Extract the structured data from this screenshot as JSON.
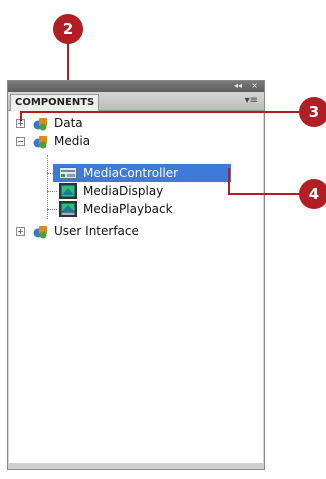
{
  "callouts": {
    "c2": "2",
    "c3": "3",
    "c4": "4"
  },
  "panel": {
    "tab_label": "COMPONENTS",
    "collapse_glyph": "◂◂",
    "close_glyph": "×",
    "menu_glyph": "▾≡"
  },
  "tree": {
    "data": {
      "label": "Data",
      "expander": "+"
    },
    "media": {
      "label": "Media",
      "expander": "−"
    },
    "media_children": [
      {
        "label": "MediaController"
      },
      {
        "label": "MediaDisplay"
      },
      {
        "label": "MediaPlayback"
      }
    ],
    "user_interface": {
      "label": "User Interface",
      "expander": "+"
    }
  },
  "colors": {
    "accent_red": "#b01f24",
    "selection_blue": "#3e7bd8"
  }
}
